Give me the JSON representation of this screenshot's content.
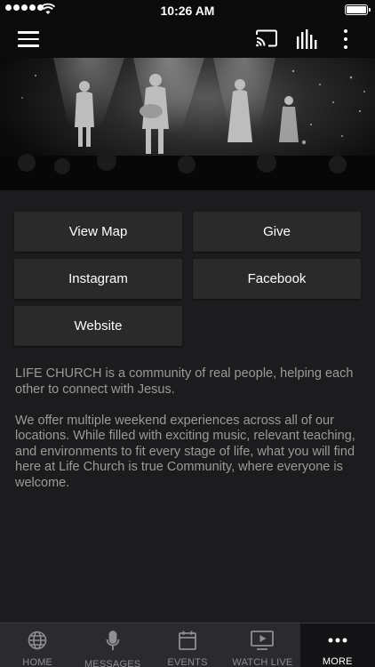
{
  "status_bar": {
    "time": "10:26 AM"
  },
  "app_bar": {},
  "buttons": {
    "view_map": "View Map",
    "give": "Give",
    "instagram": "Instagram",
    "facebook": "Facebook",
    "website": "Website"
  },
  "description": {
    "paragraph_1": "LIFE CHURCH is a community of real people, helping each other to connect with Jesus.",
    "paragraph_2": "We offer multiple weekend experiences across all of our locations. While filled with exciting music, relevant teaching, and environments to fit every stage of life, what you will find here at Life Church is true Community, where everyone is welcome."
  },
  "tabs": [
    {
      "label": "HOME",
      "icon": "globe-icon",
      "active": false
    },
    {
      "label": "MESSAGES",
      "icon": "microphone-icon",
      "active": false
    },
    {
      "label": "EVENTS",
      "icon": "calendar-icon",
      "active": false
    },
    {
      "label": "WATCH LIVE",
      "icon": "play-screen-icon",
      "active": false
    },
    {
      "label": "MORE",
      "icon": "more-dots-icon",
      "active": true
    }
  ],
  "colors": {
    "background": "#1c1c1e",
    "button": "#2a2a2a",
    "text_muted": "#9a9a9a",
    "tabbar": "#2b2b2d",
    "tab_active": "#141416"
  }
}
